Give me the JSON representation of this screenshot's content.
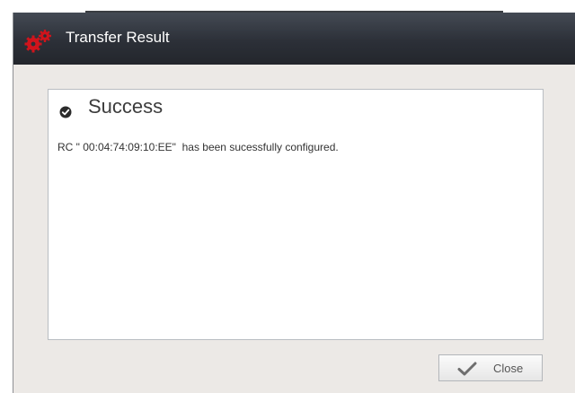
{
  "window": {
    "title": "Transfer Result",
    "icon": "gears-icon",
    "accent_color": "#d0141c"
  },
  "content": {
    "status_icon": "checkmark-circle-icon",
    "heading": "Success",
    "message": "RC \" 00:04:74:09:10:EE\"  has been sucessfully configured."
  },
  "footer": {
    "close_icon": "checkmark-icon",
    "close_label": "Close"
  }
}
